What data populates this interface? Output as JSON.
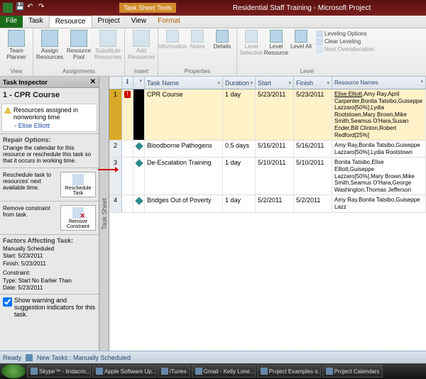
{
  "titlebar": {
    "tool_tab": "Task Sheet Tools",
    "title": "Residential Staff Training - Microsoft Project"
  },
  "menubar": {
    "tabs": [
      "File",
      "Task",
      "Resource",
      "Project",
      "View",
      "Format"
    ],
    "active_index": 2
  },
  "ribbon": {
    "groups": [
      {
        "label": "View",
        "btns": [
          {
            "name": "team-planner",
            "label": "Team Planner"
          }
        ]
      },
      {
        "label": "Assignments",
        "btns": [
          {
            "name": "assign-resources",
            "label": "Assign Resources"
          },
          {
            "name": "resource-pool",
            "label": "Resource Pool"
          },
          {
            "name": "substitute-resources",
            "label": "Substitute Resources",
            "disabled": true
          }
        ]
      },
      {
        "label": "Insert",
        "btns": [
          {
            "name": "add-resources",
            "label": "Add Resources",
            "disabled": true
          }
        ]
      },
      {
        "label": "Properties",
        "btns": [
          {
            "name": "information",
            "label": "Information",
            "disabled": true
          },
          {
            "name": "notes",
            "label": "Notes",
            "disabled": true
          },
          {
            "name": "details",
            "label": "Details"
          }
        ]
      },
      {
        "label": "Level",
        "btns": [
          {
            "name": "level-selection",
            "label": "Level Selection",
            "disabled": true
          },
          {
            "name": "level-resource",
            "label": "Level Resource"
          },
          {
            "name": "level-all",
            "label": "Level All"
          }
        ]
      }
    ],
    "level_opts": [
      "Leveling Options",
      "Clear Leveling",
      "Next Overallocation"
    ]
  },
  "inspector": {
    "title": "Task Inspector",
    "task_label": "1 - CPR Course",
    "warning": "Resources assigned in nonworking time",
    "warning_res": "Elise Elliott",
    "repair_hdr": "Repair Options:",
    "repair1_txt": "Change the calendar for this resource or reschedule this task so that it occurs in working time.",
    "repair2_txt": "Reschedule task to resources' next available time.",
    "repair2_btn": "Reschedule Task",
    "repair3_txt": "Remove constraint from task.",
    "repair3_btn": "Remove Constraint",
    "factors_hdr": "Factors Affecting Task:",
    "factors": [
      "Manually Scheduled",
      "Start: 5/23/2011",
      "Finish: 5/23/2011",
      "Constraint:",
      "Type: Start No Earlier Than",
      "Date: 5/23/2011"
    ],
    "show_warn": "Show warning and suggestion indicators for this task."
  },
  "vstrip": "Task Sheet",
  "sheet": {
    "cols": [
      "",
      "",
      "Task Mode",
      "Task Name",
      "Duration",
      "Start",
      "Finish",
      "Resource Names"
    ],
    "rows": [
      {
        "n": "1",
        "err": true,
        "name": "CPR Course",
        "dur": "1 day",
        "start": "5/23/2011",
        "finish": "5/23/2011",
        "res_u": "Elise Elliott",
        "res": ",Amy Ray,April Carpenter,Bonita Tatsibo,Guiseppe Lazzaro[50%],Lydia Rootstown,Mary Brown,Mike Smith,Seamus O'Hara,Susan Ender,Bill Clinton,Robert Redford[25%]"
      },
      {
        "n": "2",
        "name": "Bloodborne Pathogens",
        "dur": "0.5 days",
        "start": "5/16/2011",
        "finish": "5/16/2011",
        "res": "Amy Ray,Bonita Tatsibo,Guiseppe Lazzaro[50%],Lydia Rootstown"
      },
      {
        "n": "3",
        "name": "De-Escalation Training",
        "dur": "1 day",
        "start": "5/10/2011",
        "finish": "5/10/2011",
        "res": "Bonita Tatsibo,Elise Elliott,Guiseppe Lazzaro[50%],Mary Brown,Mike Smith,Seamus O'Hara,George Washington,Thomas Jefferson"
      },
      {
        "n": "4",
        "name": "Bridges Out of Poverty",
        "dur": "1 day",
        "start": "5/2/2011",
        "finish": "5/2/2011",
        "res": "Amy Ray,Bonita Tatsibo,Guiseppe Lazz"
      }
    ]
  },
  "statusbar": {
    "ready": "Ready",
    "mode": "New Tasks : Manually Scheduled"
  },
  "taskbar": {
    "items": [
      "Skype™ - lindacric…",
      "Apple Software Up…",
      "iTunes",
      "Gmail - Kelly Lone…",
      "Project Examples o…",
      "Project Calendars"
    ]
  }
}
